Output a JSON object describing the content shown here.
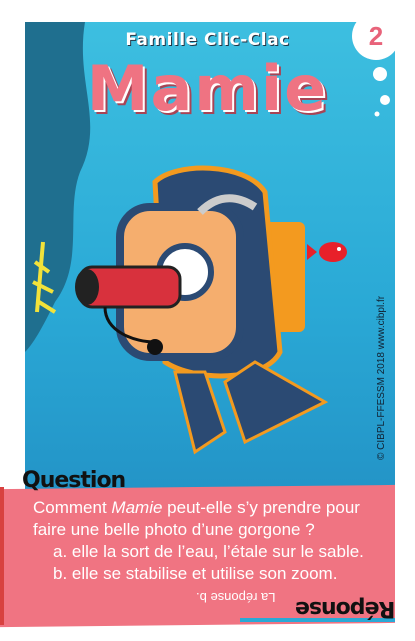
{
  "card": {
    "number": "2",
    "family": "Famille Clic-Clac",
    "character": "Mamie",
    "copyright": "© CIBPL-FFESSM 2018 www.cibpl.fr"
  },
  "question": {
    "label": "Question",
    "text_before": "Comment ",
    "text_italic": "Mamie",
    "text_after": " peut-elle s’y prendre pour faire une belle photo d’une gorgone ?",
    "options": [
      "a. elle la sort de l’eau, l’étale sur le sable.",
      "b. elle se stabilise et utilise son zoom."
    ]
  },
  "answer": {
    "label": "Réponse",
    "text": "La réponse b."
  },
  "colors": {
    "sea": "#2aa9d6",
    "pink": "#f07482",
    "title": "#ef7382"
  }
}
